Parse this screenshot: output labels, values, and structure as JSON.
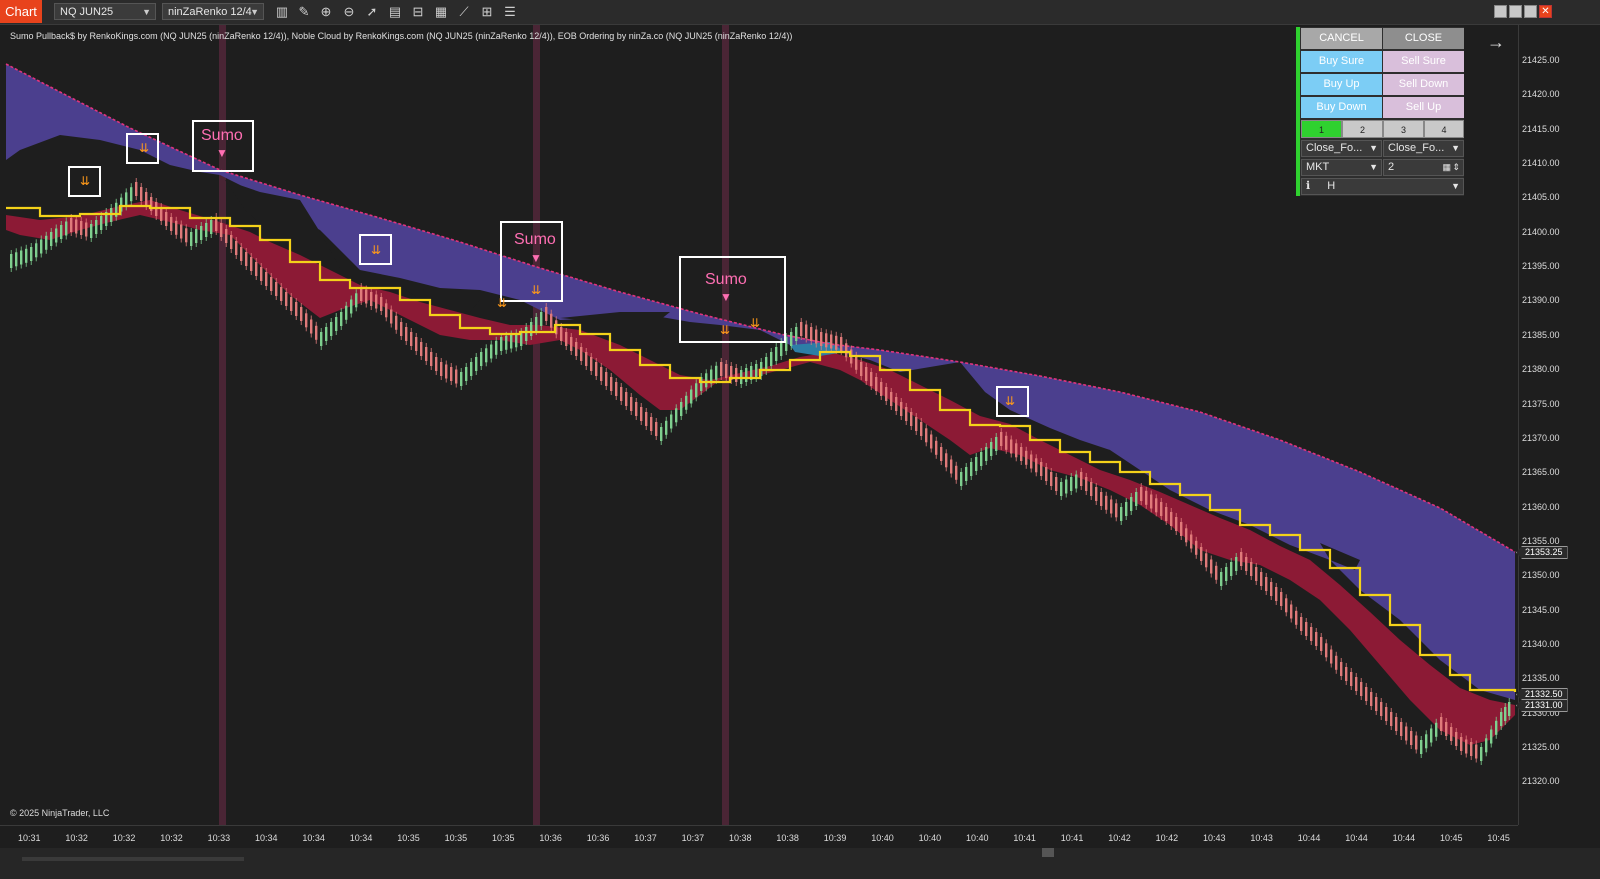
{
  "toolbar": {
    "chart_tab": "Chart",
    "instrument": "NQ JUN25",
    "bar_type": "ninZaRenko 12/4",
    "icons": [
      "bar-style-icon",
      "drawing-tool-icon",
      "zoom-in-icon",
      "zoom-out-icon",
      "pointer-icon",
      "properties-icon",
      "templates-icon",
      "strategies-icon",
      "indicators-icon",
      "chart-trader-icon"
    ],
    "window_controls": [
      "minimize-icon",
      "restore-icon",
      "maximize-icon",
      "close-icon"
    ]
  },
  "chart": {
    "indicator_label": "Sumo Pullback$ by RenkoKings.com (NQ JUN25 (ninZaRenko 12/4)), Noble Cloud by RenkoKings.com (NQ JUN25 (ninZaRenko 12/4)), EOB Ordering by ninZa.co (NQ JUN25 (ninZaRenko 12/4))",
    "copyright": "© 2025 NinjaTrader, LLC",
    "sumo_label": "Sumo",
    "signal_glyph": "⇊",
    "sumo_glyph": "▼"
  },
  "y_axis": {
    "ticks": [
      "21425.00",
      "21420.00",
      "21415.00",
      "21410.00",
      "21405.00",
      "21400.00",
      "21395.00",
      "21390.00",
      "21385.00",
      "21380.00",
      "21375.00",
      "21370.00",
      "21365.00",
      "21360.00",
      "21355.00",
      "21350.00",
      "21345.00",
      "21340.00",
      "21335.00",
      "21330.00",
      "21325.00",
      "21320.00"
    ],
    "price_tags": [
      "21353.25",
      "21332.50",
      "21331.00"
    ]
  },
  "x_axis": {
    "ticks": [
      "10:31",
      "10:32",
      "10:32",
      "10:32",
      "10:33",
      "10:34",
      "10:34",
      "10:34",
      "10:35",
      "10:35",
      "10:35",
      "10:36",
      "10:36",
      "10:37",
      "10:37",
      "10:38",
      "10:38",
      "10:39",
      "10:40",
      "10:40",
      "10:40",
      "10:41",
      "10:41",
      "10:42",
      "10:42",
      "10:43",
      "10:43",
      "10:44",
      "10:44",
      "10:44",
      "10:45",
      "10:45"
    ]
  },
  "trade_panel": {
    "cancel": "CANCEL",
    "close": "CLOSE",
    "buy_sure": "Buy Sure",
    "sell_sure": "Sell Sure",
    "buy_up": "Buy Up",
    "sell_down": "Sell Down",
    "buy_down": "Buy Down",
    "sell_up": "Sell Up",
    "tabs": [
      "1",
      "2",
      "3",
      "4"
    ],
    "close_mode_1": "Close_Fo...",
    "close_mode_2": "Close_Fo...",
    "order_type": "MKT",
    "quantity": "2",
    "info_icon": "ℹ",
    "info_value": "H"
  },
  "colors": {
    "cloud_bear": "#4b3f8e",
    "cloud_red": "#8c1a35",
    "ema": "#f4d21a",
    "trend_line": "#e0337d",
    "candle_up": "#7fcf8f",
    "candle_down": "#e07b7b",
    "vline": "#5a2a3a"
  }
}
